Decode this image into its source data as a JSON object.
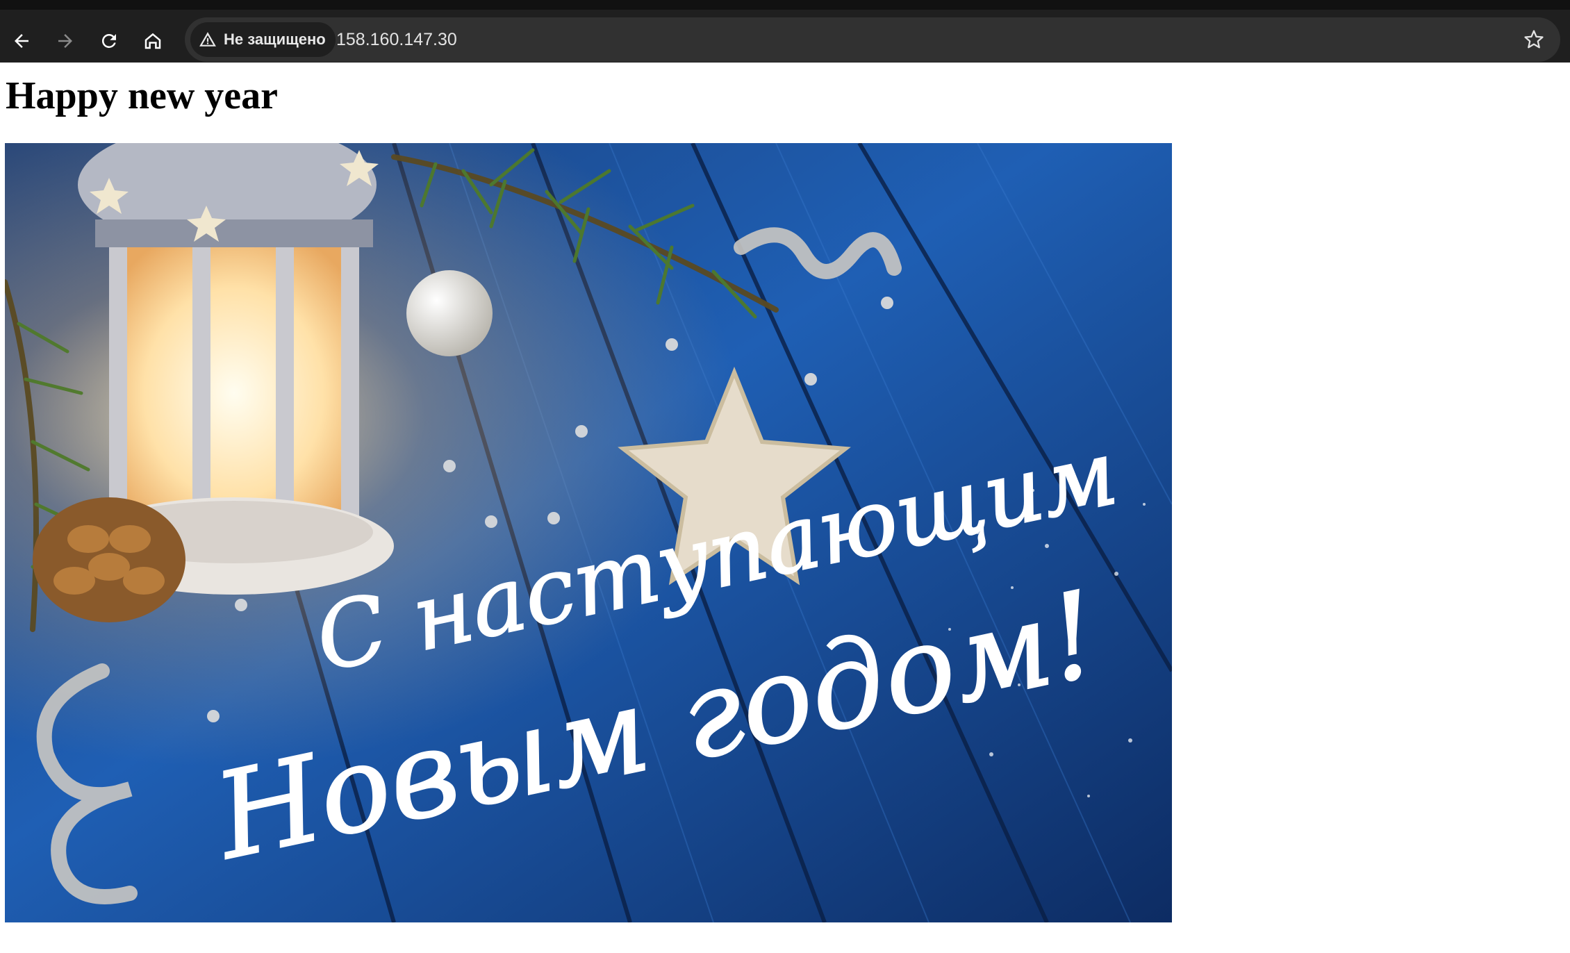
{
  "browser": {
    "nav": {
      "back_icon": "arrow-left-icon",
      "forward_icon": "arrow-right-icon",
      "reload_icon": "reload-icon",
      "home_icon": "home-icon"
    },
    "address_bar": {
      "security_label": "Не защищено",
      "security_icon": "warning-triangle-icon",
      "url": "158.160.147.30",
      "bookmark_icon": "star-outline-icon"
    },
    "colors": {
      "toolbar": "#1f1f1f",
      "omnibox": "#313131"
    }
  },
  "page": {
    "heading": "Happy new year",
    "image": {
      "greeting_line_1": "С наступающим",
      "greeting_line_2": "Новым годом!"
    }
  }
}
